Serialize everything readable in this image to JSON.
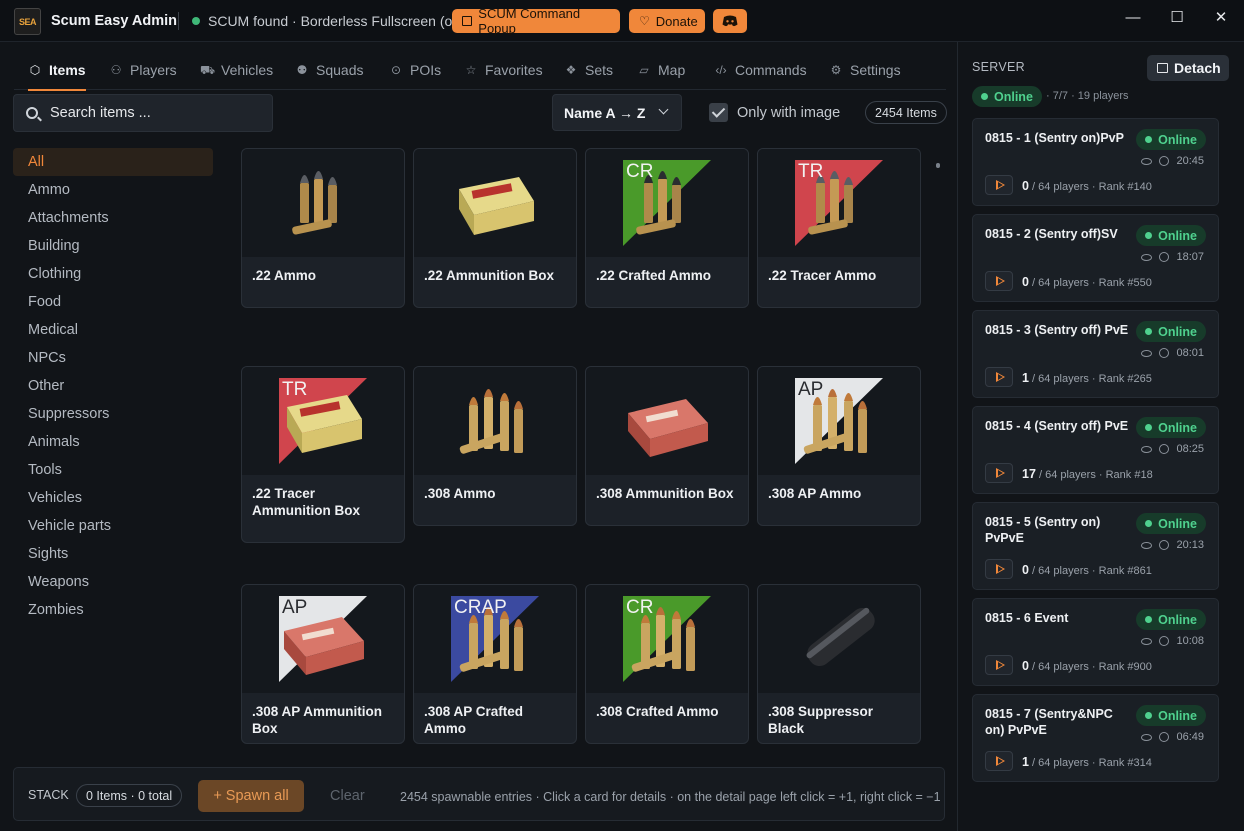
{
  "window": {
    "logo_text": "SEA",
    "title": "Scum Easy Admin",
    "status": "SCUM found · Borderless Fullscreen (ok)",
    "popup_button": "SCUM Command Popup",
    "donate_button": "Donate",
    "controls": {
      "minimize": "—",
      "maximize": "☐",
      "close": "✕"
    }
  },
  "tabs": [
    {
      "label": "Items",
      "icon": "cube-icon",
      "glyph": "⬡"
    },
    {
      "label": "Players",
      "icon": "users-icon",
      "glyph": "⚇"
    },
    {
      "label": "Vehicles",
      "icon": "car-icon",
      "glyph": "⛟"
    },
    {
      "label": "Squads",
      "icon": "squad-icon",
      "glyph": "⚉"
    },
    {
      "label": "POIs",
      "icon": "pin-icon",
      "glyph": "⊙"
    },
    {
      "label": "Favorites",
      "icon": "star-icon",
      "glyph": "☆"
    },
    {
      "label": "Sets",
      "icon": "layers-icon",
      "glyph": "❖"
    },
    {
      "label": "Map",
      "icon": "map-icon",
      "glyph": "▱"
    },
    {
      "label": "Commands",
      "icon": "code-icon",
      "glyph": "‹/›"
    },
    {
      "label": "Settings",
      "icon": "gear-icon",
      "glyph": "⚙"
    }
  ],
  "search": {
    "placeholder": "Search items ...",
    "value": ""
  },
  "sort": {
    "selected": "Name A → Z"
  },
  "only_with_image": {
    "label": "Only with image",
    "checked": true
  },
  "item_count": "2454 Items",
  "categories": [
    "All",
    "Ammo",
    "Attachments",
    "Building",
    "Clothing",
    "Food",
    "Medical",
    "NPCs",
    "Other",
    "Suppressors",
    "Animals",
    "Tools",
    "Vehicles",
    "Vehicle parts",
    "Sights",
    "Weapons",
    "Zombies"
  ],
  "active_category": "All",
  "items": [
    {
      "name": ".22 Ammo",
      "tag": "",
      "kind": "small-bullets"
    },
    {
      "name": ".22 Ammunition Box",
      "tag": "",
      "kind": "box-yellow"
    },
    {
      "name": ".22 Crafted Ammo",
      "tag": "CR",
      "tag_color": "#4a9a2a",
      "kind": "small-bullets-dark"
    },
    {
      "name": ".22 Tracer Ammo",
      "tag": "TR",
      "tag_color": "#d0454d",
      "kind": "small-bullets"
    },
    {
      "name": ".22 Tracer Ammunition Box",
      "tag": "TR",
      "tag_color": "#d0454d",
      "kind": "box-yellow"
    },
    {
      "name": ".308 Ammo",
      "tag": "",
      "kind": "rifle-bullets"
    },
    {
      "name": ".308 Ammunition Box",
      "tag": "",
      "kind": "box-red"
    },
    {
      "name": ".308 AP Ammo",
      "tag": "AP",
      "tag_color": "#e4e6e8",
      "kind": "rifle-bullets"
    },
    {
      "name": ".308 AP Ammunition Box",
      "tag": "AP",
      "tag_color": "#e4e6e8",
      "kind": "box-red"
    },
    {
      "name": ".308 AP Crafted Ammo",
      "tag": "CRAP",
      "tag_color": "#3b4aa0",
      "kind": "rifle-bullets"
    },
    {
      "name": ".308 Crafted Ammo",
      "tag": "CR",
      "tag_color": "#4a9a2a",
      "kind": "rifle-bullets"
    },
    {
      "name": ".308 Suppressor Black",
      "tag": "",
      "kind": "suppressor"
    }
  ],
  "stack": {
    "label": "STACK",
    "badge": "0 Items · 0 total",
    "spawn_button": "+ Spawn all",
    "clear_button": "Clear",
    "hint": "2454 spawnable entries · Click a card for details · on the detail page left click = +1, right click = −1"
  },
  "server_panel": {
    "title": "SERVER",
    "detach_button": "Detach",
    "status": "Online",
    "summary": "· 7/7 · 19 players",
    "servers": [
      {
        "name": "0815 - 1 (Sentry on)PvP",
        "status": "Online",
        "time": "20:45",
        "players": "0",
        "capacity": "/ 64 players · Rank #140"
      },
      {
        "name": "0815 - 2 (Sentry off)SV",
        "status": "Online",
        "time": "18:07",
        "players": "0",
        "capacity": "/ 64 players · Rank #550"
      },
      {
        "name": "0815 - 3 (Sentry off) PvE",
        "status": "Online",
        "time": "08:01",
        "players": "1",
        "capacity": "/ 64 players · Rank #265"
      },
      {
        "name": "0815 - 4 (Sentry off) PvE",
        "status": "Online",
        "time": "08:25",
        "players": "17",
        "capacity": "/ 64 players · Rank #18"
      },
      {
        "name": "0815 - 5 (Sentry on) PvPvE",
        "status": "Online",
        "time": "20:13",
        "players": "0",
        "capacity": "/ 64 players · Rank #861"
      },
      {
        "name": "0815 - 6 Event",
        "status": "Online",
        "time": "10:08",
        "players": "0",
        "capacity": "/ 64 players · Rank #900"
      },
      {
        "name": "0815 - 7 (Sentry&NPC on) PvPvE",
        "status": "Online",
        "time": "06:49",
        "players": "1",
        "capacity": "/ 64 players · Rank #314"
      }
    ]
  },
  "colors": {
    "accent": "#f0873a",
    "online": "#4fd18e",
    "background": "#111418"
  }
}
